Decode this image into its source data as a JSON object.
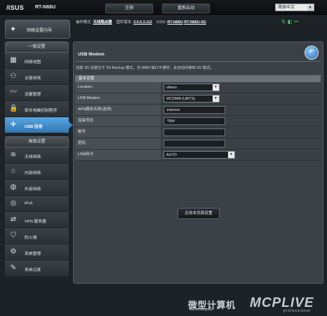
{
  "header": {
    "brand": "/ISUS",
    "model": "RT-N66U",
    "logout_label": "注销",
    "reboot_label": "重新启动",
    "language": "简体中文"
  },
  "quick": {
    "label": "网络设置向导"
  },
  "status": {
    "mode_label": "操作模式:",
    "mode_value": "无线路由器",
    "firmware_label": "固件版本:",
    "firmware_value": "3.0.0.3.112",
    "ssid_label": "SSID:",
    "ssid_value_1": "RT-N66U",
    "ssid_value_2": "RT-N66U-5G"
  },
  "sidebar": {
    "general_header": "一般设置",
    "general_items": [
      {
        "label": "网络地图",
        "icon": "network-map-icon",
        "glyph": "▦"
      },
      {
        "label": "访客网络",
        "icon": "guest-network-icon",
        "glyph": "⚇"
      },
      {
        "label": "流量管理",
        "icon": "traffic-icon",
        "glyph": "〰"
      },
      {
        "label": "家长电脑控制程序",
        "icon": "lock-icon",
        "glyph": "🔒"
      },
      {
        "label": "USB 应用",
        "icon": "puzzle-icon",
        "glyph": "✚"
      }
    ],
    "advanced_header": "高级设置",
    "advanced_items": [
      {
        "label": "无线网络",
        "icon": "wireless-icon",
        "glyph": "≋"
      },
      {
        "label": "内部网络",
        "icon": "home-icon",
        "glyph": "⌂"
      },
      {
        "label": "外部网络",
        "icon": "globe-icon",
        "glyph": "◍"
      },
      {
        "label": "IPv6",
        "icon": "ipv6-icon",
        "glyph": "◎"
      },
      {
        "label": "VPN 服务器",
        "icon": "vpn-icon",
        "glyph": "⇄"
      },
      {
        "label": "防火墙",
        "icon": "shield-icon",
        "glyph": "⛉"
      },
      {
        "label": "系统管理",
        "icon": "admin-icon",
        "glyph": "⚙"
      },
      {
        "label": "系统记录",
        "icon": "log-icon",
        "glyph": "✎"
      }
    ]
  },
  "panel": {
    "title": "USB Modem",
    "description": "当前 3G 设置位于 3G Backup 模式。当 WAN 接口不通时，会自动切换到 3G 模式。",
    "section_header": "基本设置",
    "rows": {
      "location": {
        "label": "Location",
        "value": "others"
      },
      "modem": {
        "label": "USB Modem",
        "value": "WCDMA (UMTS)"
      },
      "apn": {
        "label": "APN服务名称(选项)",
        "value": "internet"
      },
      "dial": {
        "label": "连接号码",
        "value": "*99#"
      },
      "account": {
        "label": "帐号",
        "value": ""
      },
      "password": {
        "label": "密码",
        "value": ""
      },
      "adapter": {
        "label": "USB网卡",
        "value": "AUTO"
      }
    },
    "apply_label": "应用本页面设置"
  },
  "watermark": {
    "cn": "微型计算机",
    "sub": "MicroComputer",
    "logo": "MCPLIVE",
    "prof": "professional"
  }
}
